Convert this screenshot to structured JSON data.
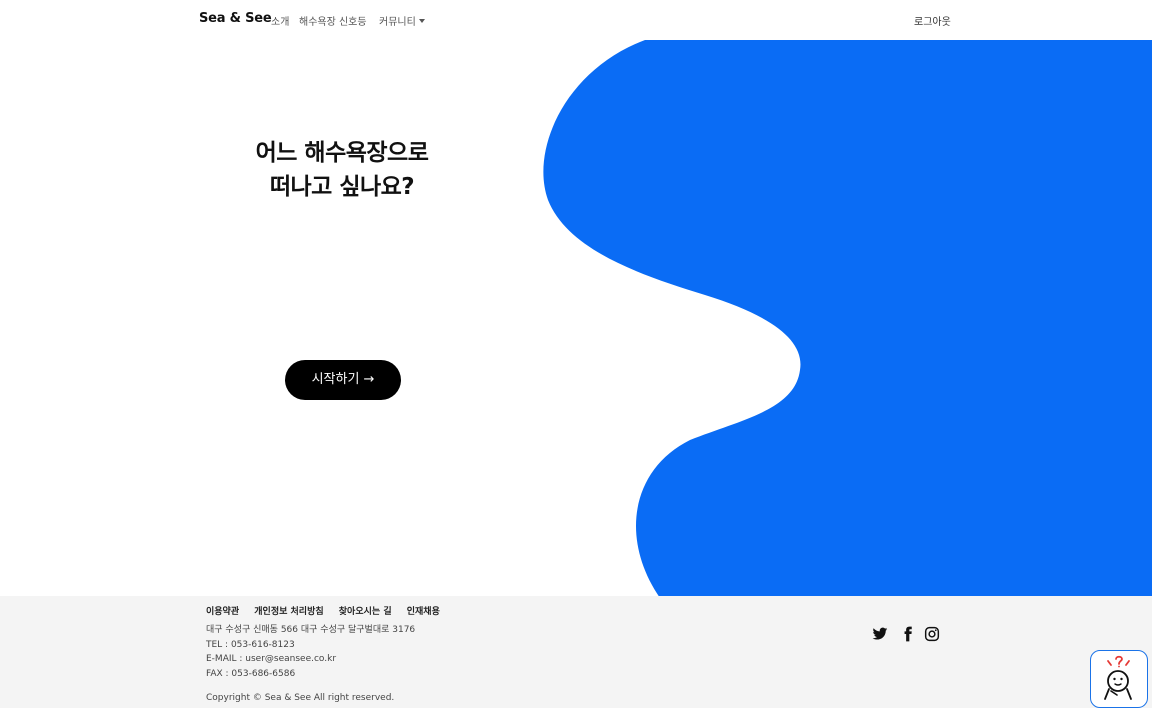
{
  "colors": {
    "accent_blue": "#0a6cf5",
    "button_bg": "#000000",
    "footer_bg": "#f4f4f4"
  },
  "nav": {
    "brand": "Sea & See",
    "items": [
      {
        "label": "소개"
      },
      {
        "label": "해수욕장 신호등"
      },
      {
        "label": "커뮤니티"
      }
    ],
    "logout": "로그아웃"
  },
  "hero": {
    "title_line1": "어느 해수욕장으로",
    "title_line2": "떠나고 싶나요?",
    "start_button": "시작하기 →"
  },
  "footer": {
    "links": [
      {
        "label": "이용약관"
      },
      {
        "label": "개인정보 처리방침"
      },
      {
        "label": "찾아오시는 길"
      },
      {
        "label": "인재채용"
      }
    ],
    "address": "대구 수성구 신매동 566 대구 수성구 달구벌대로 3176",
    "tel": "TEL : 053-616-8123",
    "email": "E-MAIL : user@seansee.co.kr",
    "fax": "FAX : 053-686-6586",
    "copyright": "Copyright © Sea & See All right reserved.",
    "socials": [
      {
        "icon": "twitter-icon"
      },
      {
        "icon": "facebook-icon"
      },
      {
        "icon": "instagram-icon"
      }
    ]
  },
  "widget": {
    "icon": "help-character-icon"
  }
}
